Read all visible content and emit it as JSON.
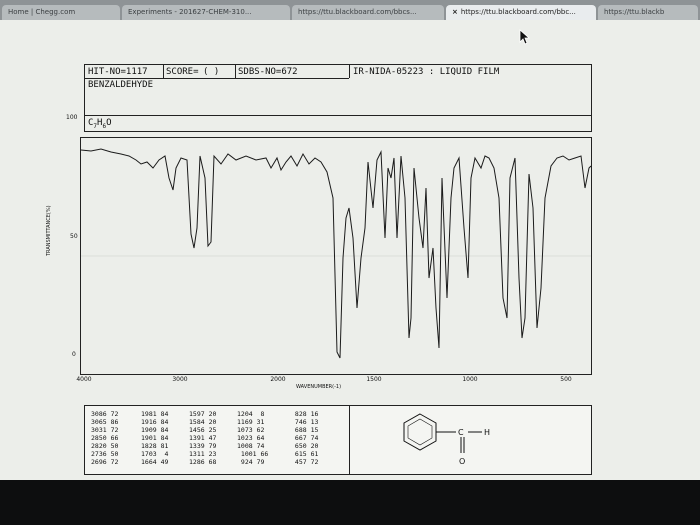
{
  "browser": {
    "tabs": [
      {
        "title": "Home | Chegg.com",
        "active": false
      },
      {
        "title": "Experiments - 201627-CHEM-310...",
        "active": false
      },
      {
        "title": "https://ttu.blackboard.com/bbcs...",
        "active": false
      },
      {
        "title": "https://ttu.blackboard.com/bbc...",
        "active": true
      },
      {
        "title": "https://ttu.blackb",
        "active": false
      }
    ],
    "close_glyph": "×"
  },
  "spectrum": {
    "hit_no": "HIT-NO=1117",
    "score": "SCORE=",
    "score_value": "(  )",
    "sdbs_no": "SDBS-NO=672",
    "ir_nida": "IR-NIDA-05223 : LIQUID FILM",
    "compound": "BENZALDEHYDE",
    "formula_parts": [
      "C",
      "7",
      "H",
      "6",
      "O"
    ],
    "y_axis": {
      "title": "TRANSMITTANCE(%)",
      "ticks": [
        "100",
        "50",
        "0"
      ]
    },
    "x_axis": {
      "title": "WAVENUMBER(-1)",
      "ticks": [
        "4000",
        "3000",
        "2000",
        "1500",
        "1000",
        "500"
      ]
    }
  },
  "peak_table": [
    [
      "3086 72",
      "3065 86",
      "3031 72",
      "2850 66",
      "2820 50",
      "2736 50",
      "2696 72"
    ],
    [
      "1981 84",
      "1916 84",
      "1909 84",
      "1901 84",
      "1828 81",
      "1703  4",
      "1664 49"
    ],
    [
      "1597 20",
      "1584 20",
      "1456 25",
      "1391 47",
      "1339 79",
      "1311 23",
      "1286 68"
    ],
    [
      "1204  8",
      "1169 31",
      "1073 62",
      "1023 64",
      "1008 74",
      " 1001 66",
      " 924 79"
    ],
    [
      " 828 16",
      " 746 13",
      " 688 15",
      " 667 74",
      " 650 20",
      " 615 61",
      " 457 72"
    ]
  ],
  "structure": {
    "ring_sub": "C",
    "h": "H",
    "o": "O"
  }
}
